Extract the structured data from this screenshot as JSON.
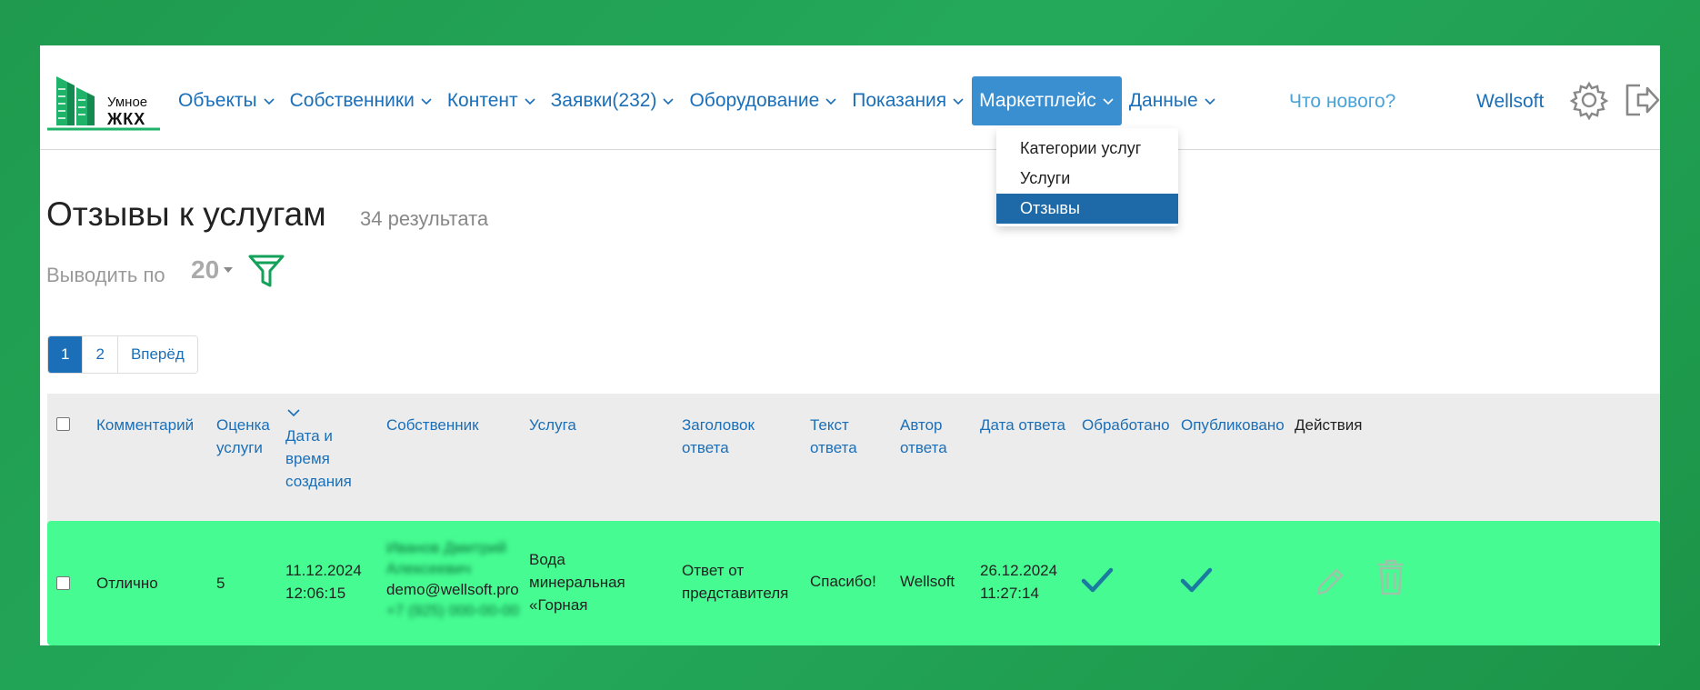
{
  "header": {
    "logo": {
      "line1": "Умное",
      "line2": "ЖКХ"
    },
    "nav": [
      {
        "label": "Объекты"
      },
      {
        "label": "Собственники"
      },
      {
        "label": "Контент"
      },
      {
        "label": "Заявки(232)"
      },
      {
        "label": "Оборудование"
      },
      {
        "label": "Показания"
      },
      {
        "label": "Маркетплейс",
        "active": true
      },
      {
        "label": "Данные"
      }
    ],
    "whats_new": "Что нового?",
    "user": "Wellsoft",
    "icons": [
      "settings-gear-icon",
      "logout-icon"
    ]
  },
  "dropdown": {
    "items": [
      {
        "label": "Категории услуг"
      },
      {
        "label": "Услуги"
      },
      {
        "label": "Отзывы",
        "selected": true
      }
    ]
  },
  "page": {
    "title": "Отзывы к услугам",
    "count": "34 результата",
    "per_page_label": "Выводить по",
    "per_page_value": "20"
  },
  "pagination": {
    "pages": [
      "1",
      "2"
    ],
    "next": "Вперёд",
    "current": "1"
  },
  "table": {
    "columns": {
      "comment": "Комментарий",
      "rating_l1": "Оценка",
      "rating_l2": "услуги",
      "created_l1": "Дата и",
      "created_l2": "время",
      "created_l3": "создания",
      "owner": "Собственник",
      "service": "Услуга",
      "answer_title_l1": "Заголовок",
      "answer_title_l2": "ответа",
      "answer_text_l1": "Текст",
      "answer_text_l2": "ответа",
      "answer_author_l1": "Автор",
      "answer_author_l2": "ответа",
      "answer_date": "Дата ответа",
      "processed": "Обработано",
      "published": "Опубликовано",
      "actions": "Действия"
    },
    "rows": [
      {
        "comment": "Отлично",
        "rating": "5",
        "created_date": "11.12.2024",
        "created_time": "12:06:15",
        "owner_name_l1": "Иванов Дмитрий",
        "owner_name_l2": "Алексеевич",
        "owner_email": "demo@wellsoft.pro",
        "owner_phone": "+7 (925) 000-00-00",
        "service_l1": "Вода",
        "service_l2": "минеральная",
        "service_l3": "«Горная",
        "answer_title_l1": "Ответ от",
        "answer_title_l2": "представителя",
        "answer_text": "Спасибо!",
        "answer_author": "Wellsoft",
        "answer_date": "26.12.2024",
        "answer_time": "11:27:14",
        "processed": true,
        "published": true
      }
    ]
  },
  "colors": {
    "accent": "#1a6fb8",
    "active_nav": "#3a8fd1",
    "row_highlight": "#46fc92",
    "background": "#1f9a4e"
  }
}
